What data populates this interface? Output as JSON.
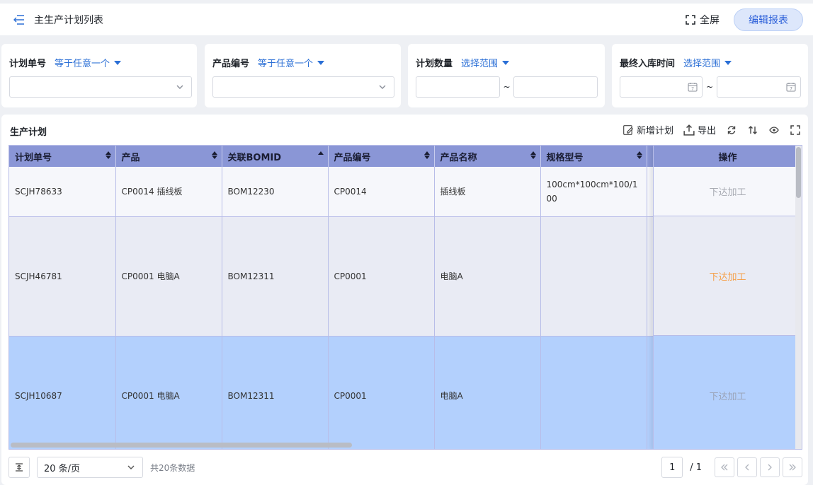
{
  "header": {
    "title": "主生产计划列表",
    "fullscreen_label": "全屏",
    "edit_report_label": "编辑报表"
  },
  "filters": [
    {
      "label": "计划单号",
      "operator": "等于任意一个",
      "type": "select"
    },
    {
      "label": "产品编号",
      "operator": "等于任意一个",
      "type": "select"
    },
    {
      "label": "计划数量",
      "operator": "选择范围",
      "type": "range",
      "separator": "~"
    },
    {
      "label": "最终入库时间",
      "operator": "选择范围",
      "type": "date-range",
      "separator": "~"
    }
  ],
  "panel": {
    "title": "生产计划",
    "toolbar": {
      "add_label": "新增计划",
      "export_label": "导出"
    }
  },
  "table": {
    "columns": [
      "计划单号",
      "产品",
      "关联BOMID",
      "产品编号",
      "产品名称",
      "规格型号"
    ],
    "action_column": "操作",
    "rows": [
      {
        "plan_no": "SCJH78633",
        "product": "CP0014 插线板",
        "bom": "BOM12230",
        "product_code": "CP0014",
        "product_name": "插线板",
        "spec": "100cm*100cm*100/100",
        "action": "下达加工"
      },
      {
        "plan_no": "SCJH46781",
        "product": "CP0001 电脑A",
        "bom": "BOM12311",
        "product_code": "CP0001",
        "product_name": "电脑A",
        "spec": "",
        "action": "下达加工"
      },
      {
        "plan_no": "SCJH10687",
        "product": "CP0001 电脑A",
        "bom": "BOM12311",
        "product_code": "CP0001",
        "product_name": "电脑A",
        "spec": "",
        "action": "下达加工"
      }
    ]
  },
  "footer": {
    "page_size": "20 条/页",
    "total": "共20条数据",
    "current_page": "1",
    "page_total": "/ 1"
  },
  "colors": {
    "accent": "#2b6fd6",
    "header_row": "#8a96d6",
    "selected_row": "#b3d0fd",
    "action_active": "#f5a04a"
  }
}
